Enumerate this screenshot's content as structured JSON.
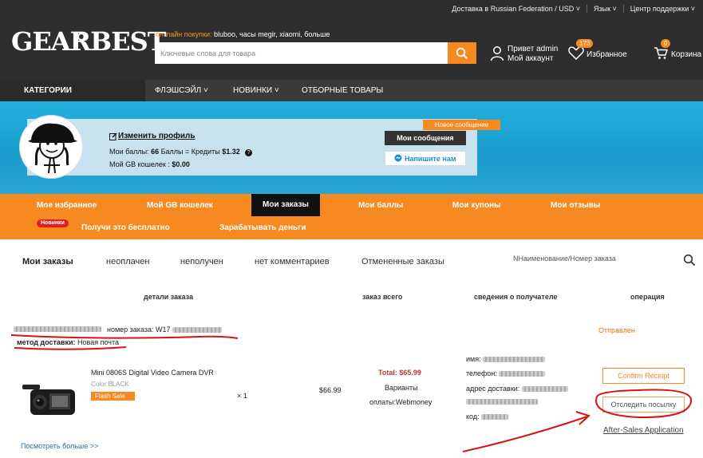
{
  "header": {
    "top_links": [
      "Доставка в Russian Federation / USD ˅",
      "Язык ˅",
      "Центр поддержки ˅"
    ],
    "logo": "GEARBEST",
    "hot_label": "он-лайн покупки:",
    "hot_items": "bluboo,   часы megir,   xiaomi,   больше",
    "search_placeholder": "Ключевые слова для товара",
    "account_greeting": "Привет admin",
    "account_label": "Мой аккаунт",
    "favorites_count": "173",
    "favorites_label": "Избранное",
    "cart_count": "0",
    "cart_label": "Корзина"
  },
  "nav": {
    "categories": "КАТЕГОРИИ",
    "items": [
      "ФЛЭШСЭЙЛ ˅",
      "НОВИНКИ ˅",
      "ОТБОРНЫЕ ТОВАРЫ"
    ]
  },
  "profile": {
    "edit_label": "Изменить профиль",
    "points_label": "Мои баллы:",
    "points_value": "66",
    "points_suffix": "Баллы = Кредиты",
    "credits_value": "$1.32",
    "wallet_label": "Мой GB кошелек",
    "wallet_value": "$0.00",
    "new_message": "Новое сообщение",
    "messages_button": "Мои сообщения",
    "write_button": "Напишите нам"
  },
  "account_tabs": {
    "row1": [
      "Мое избранное",
      "Мой GB кошелек",
      "Мои заказы",
      "Мои баллы",
      "Мои купоны",
      "Мои отзывы"
    ],
    "new_badge": "Новинки",
    "row2": [
      "Получи это бесплатно",
      "Зарабатывать деньги"
    ]
  },
  "orders": {
    "tabs": [
      "Мои заказы",
      "неоплачен",
      "неполучен",
      "нет комментариев",
      "Отмененные заказы"
    ],
    "search_placeholder": "NНаименование/Номер заказа",
    "columns": [
      "детали заказа",
      "заказ всего",
      "сведения о получателе",
      "операция"
    ],
    "order_number_label": "номер заказа:",
    "order_number_prefix": "W17",
    "delivery_label": "метод доставки:",
    "delivery_value": "Новая почта",
    "status": "Отправлен",
    "product_name": "Mini 0806S Digital Video Camera DVR",
    "product_color": "Color:BLACK",
    "flash_sale": "Flash Sale",
    "quantity": "× 1",
    "price": "$66.99",
    "total": "Total: $65.99",
    "payment_label": "Варианты",
    "payment_value": "оплаты:Webmoney",
    "recipient_fields": [
      "имя:",
      "телефон:",
      "адрес доставки:",
      "код:"
    ],
    "confirm_button": "Confirm Receipt",
    "track_button": "Отследить посылку",
    "after_sales": "After-Sales Application",
    "view_more": "Посмотреть больше >>"
  },
  "colors": {
    "accent": "#f6891f",
    "header_dark": "#2e2e2e",
    "banner_blue": "#22b0dc",
    "annotation_red": "#d61414"
  }
}
